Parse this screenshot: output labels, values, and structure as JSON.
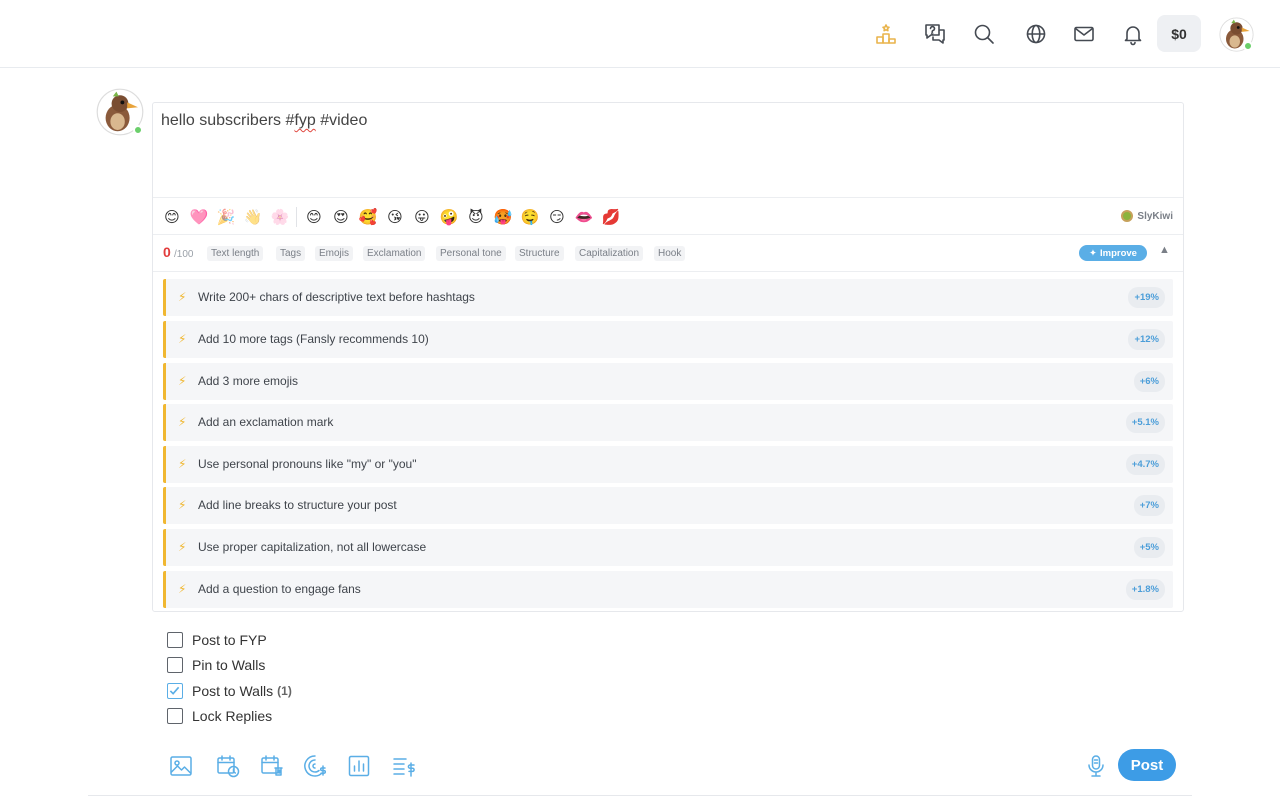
{
  "header": {
    "balance": "$0",
    "icons": [
      "leaderboard-icon",
      "help-chat-icon",
      "search-icon",
      "globe-icon",
      "mail-icon",
      "bell-icon"
    ]
  },
  "composer": {
    "text_before": "hello subscribers #",
    "text_misspelled": "fyp",
    "text_after": " #video",
    "emojis": [
      "😊",
      "🩷",
      "🎉",
      "👋",
      "🌸",
      "😊",
      "😍",
      "🥰",
      "😘",
      "😛",
      "🤪",
      "😈",
      "🥵",
      "🤤",
      "😏",
      "👄",
      "💋"
    ],
    "brand": "SlyKiwi"
  },
  "score": {
    "value": "0",
    "max": "/100",
    "chips": [
      "Text length",
      "Tags",
      "Emojis",
      "Exclamation",
      "Personal tone",
      "Structure",
      "Capitalization",
      "Hook"
    ],
    "improve_label": "Improve",
    "collapse_glyph": "▲"
  },
  "suggestions": [
    {
      "text": "Write 200+ chars of descriptive text before hashtags",
      "gain": "+19%"
    },
    {
      "text": "Add 10 more tags (Fansly recommends 10)",
      "gain": "+12%"
    },
    {
      "text": "Add 3 more emojis",
      "gain": "+6%"
    },
    {
      "text": "Add an exclamation mark",
      "gain": "+5.1%"
    },
    {
      "text": "Use personal pronouns like \"my\" or \"you\"",
      "gain": "+4.7%"
    },
    {
      "text": "Add line breaks to structure your post",
      "gain": "+7%"
    },
    {
      "text": "Use proper capitalization, not all lowercase",
      "gain": "+5%"
    },
    {
      "text": "Add a question to engage fans",
      "gain": "+1.8%"
    }
  ],
  "options": {
    "post_to_fyp": {
      "label": "Post to FYP",
      "checked": false
    },
    "pin_to_walls": {
      "label": "Pin to Walls",
      "checked": false
    },
    "post_to_walls": {
      "label": "Post to Walls",
      "count": "(1)",
      "checked": true
    },
    "lock_replies": {
      "label": "Lock Replies",
      "checked": false
    }
  },
  "actions": {
    "post_label": "Post",
    "tools": [
      "image-icon",
      "schedule-icon",
      "expire-calendar-icon",
      "tip-goal-icon",
      "poll-icon",
      "price-list-icon"
    ],
    "mic": "microphone-icon"
  },
  "colors": {
    "accent": "#3d9ce6",
    "score_red": "#e23c3c",
    "suggestion_bar": "#f0b731",
    "online": "#6bcf6b"
  }
}
